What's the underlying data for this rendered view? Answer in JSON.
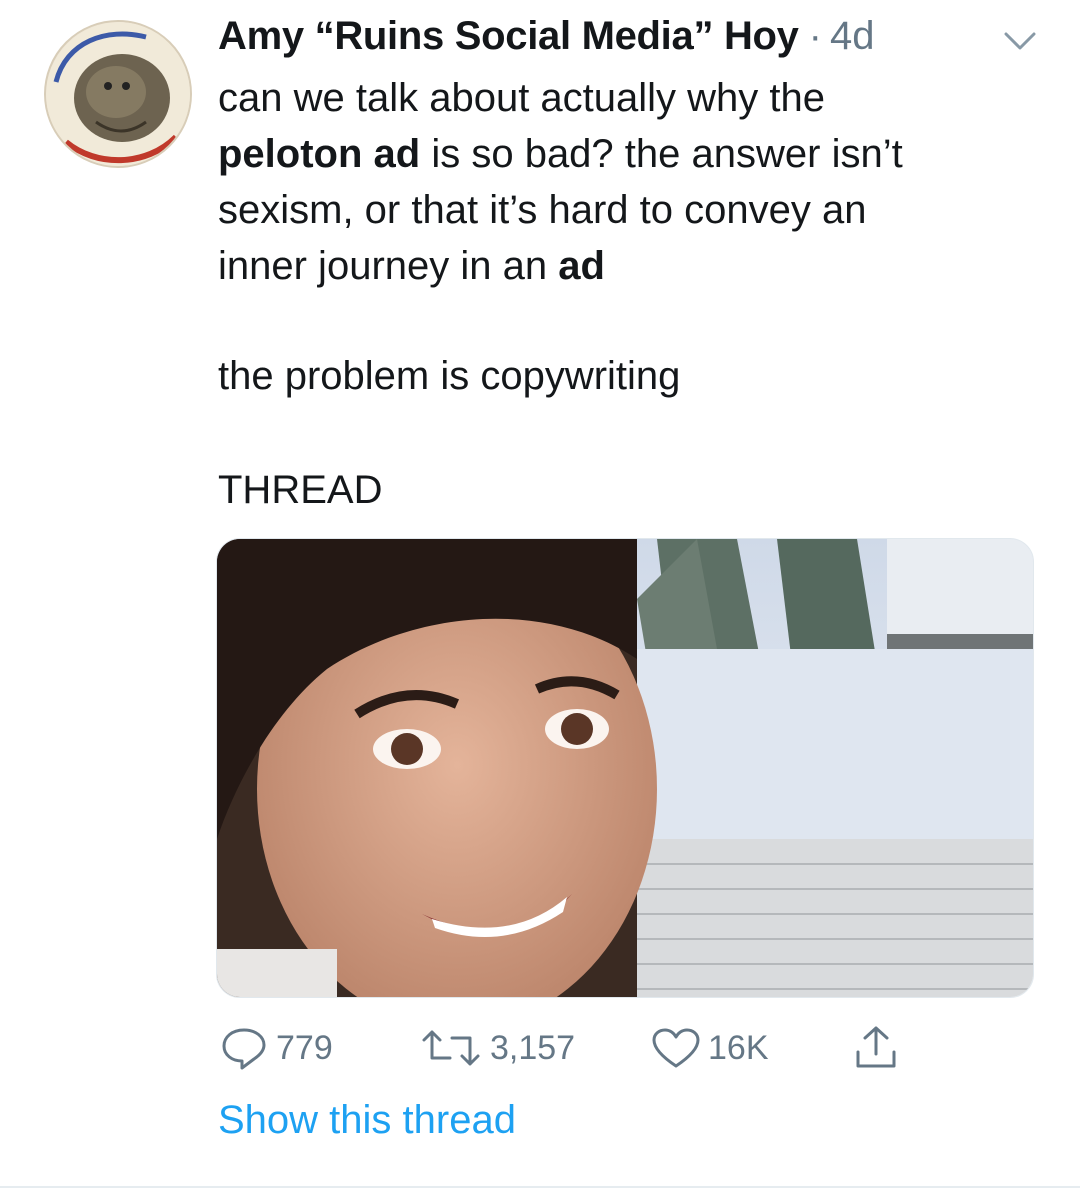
{
  "tweet": {
    "author_name": "Amy “Ruins Social Media” Hoy",
    "separator": "·",
    "time": "4d",
    "text": {
      "line1_a": "can we talk about actually why the",
      "line2_bold": "peloton ad",
      "line2_rest": " is so bad? the answer isn’t",
      "line3": "sexism, or that it’s hard to convey an",
      "line4_a": "inner journey in an ",
      "line4_bold": "ad",
      "para2": "the problem is copywriting",
      "para3": "THREAD"
    },
    "actions": {
      "replies": "779",
      "retweets": "3,157",
      "likes": "16K"
    },
    "show_thread": "Show this thread"
  },
  "colors": {
    "text": "#14171a",
    "secondary": "#657786",
    "link": "#1da1f2"
  },
  "icons": [
    "chevron-down-icon",
    "reply-icon",
    "retweet-icon",
    "like-icon",
    "share-icon"
  ]
}
